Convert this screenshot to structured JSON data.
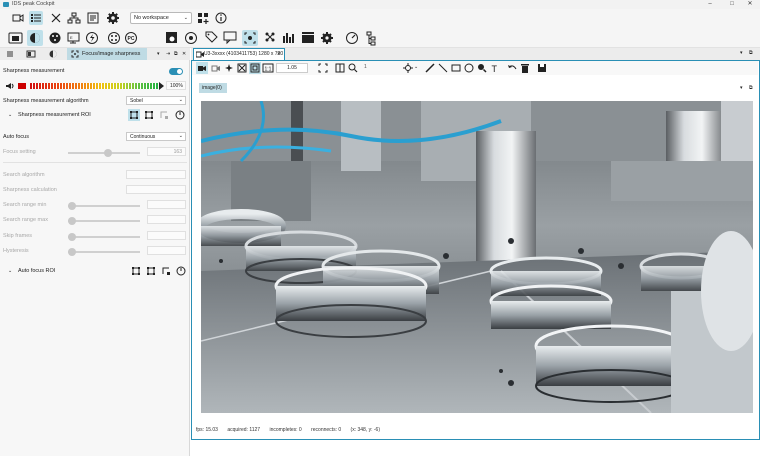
{
  "window": {
    "title": "IDS peak Cockpit",
    "controls": [
      "minimize",
      "maximize",
      "close"
    ]
  },
  "toolbar1": {
    "icons": [
      "camera-icon",
      "list-icon",
      "close-icon",
      "network-icon",
      "document-icon",
      "gear-icon"
    ],
    "workspace": "No workspace",
    "extra_icons": [
      "add-workspace-icon",
      "info-icon"
    ]
  },
  "toolbar2": {
    "icons": [
      "video-icon",
      "contrast-icon",
      "palette-icon",
      "monitor-icon",
      "lightning-icon",
      "dots-circle-icon",
      "pc-icon",
      "camera-settings-icon",
      "dial-icon",
      "tag-icon",
      "chat-icon",
      "chart-icon",
      "gear-icon",
      "focus-icon",
      "nodes-icon",
      "bars-icon",
      "clapper-icon",
      "gear-icon",
      "gauge-icon",
      "tree-icon"
    ]
  },
  "left_panel": {
    "tab_label": "Focus/image sharpness",
    "sharpness_measurement": {
      "label": "Sharpness measurement",
      "value": "100%",
      "algorithm_label": "Sharpness measurement algorithm",
      "algorithm": "Sobel",
      "roi_label": "Sharpness measurement ROI"
    },
    "auto_focus": {
      "label": "Auto focus",
      "mode": "Continuous",
      "focus_setting_label": "Focus setting",
      "focus_setting_value": "163",
      "focus_setting_level": 0.55,
      "search_algorithm_label": "Search algorithm",
      "sharpness_calc_label": "Sharpness calculation",
      "search_range_min_label": "Search range min",
      "search_range_max_label": "Search range max",
      "skip_frames_label": "Skip frames",
      "hysteresis_label": "Hysteresis",
      "roi_label": "Auto focus ROI"
    }
  },
  "right_panel": {
    "tab_label": "U3-3xxxx (4103411753) 1280 x 720",
    "zoom": "1.05",
    "zoom_percent": "1",
    "image_tab": "image(0)",
    "status": {
      "fps": "fps: 15.03",
      "acquired": "acquired: 1127",
      "incompletes": "incompletes: 0",
      "reconnects": "reconnects: 0",
      "coords": "(x: 348, y: -6)"
    }
  },
  "colors": {
    "accent": "#2a8fb5",
    "accent_light": "#bfdbe4"
  }
}
